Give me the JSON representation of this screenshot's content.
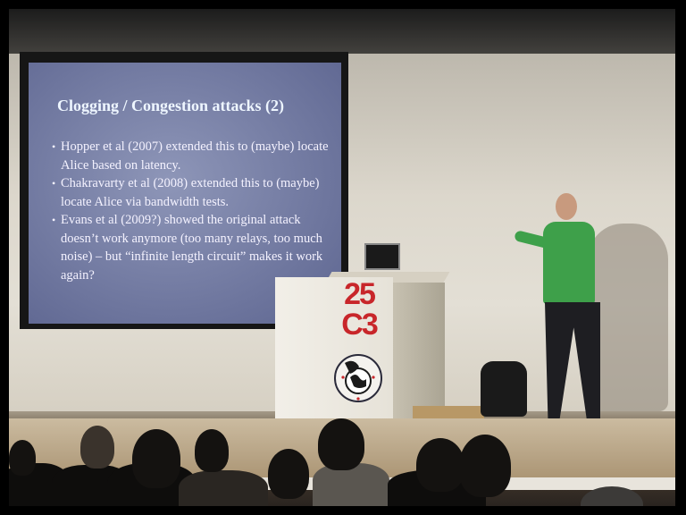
{
  "slide": {
    "title": "Clogging / Congestion attacks (2)",
    "bullets": [
      "Hopper et al (2007) extended this to (maybe) locate Alice based on latency.",
      "Chakravarty et al (2008) extended this to (maybe) locate Alice via bandwidth tests.",
      "Evans et al (2009?) showed the original attack doesn’t work anymore (too many relays, too much noise) – but “infinite length circuit” makes it work again?"
    ]
  },
  "podium": {
    "logo_line1": "25",
    "logo_line2": "C3",
    "logo_color": "#c8262a"
  },
  "speaker": {
    "shirt_color": "#3ea04a"
  }
}
